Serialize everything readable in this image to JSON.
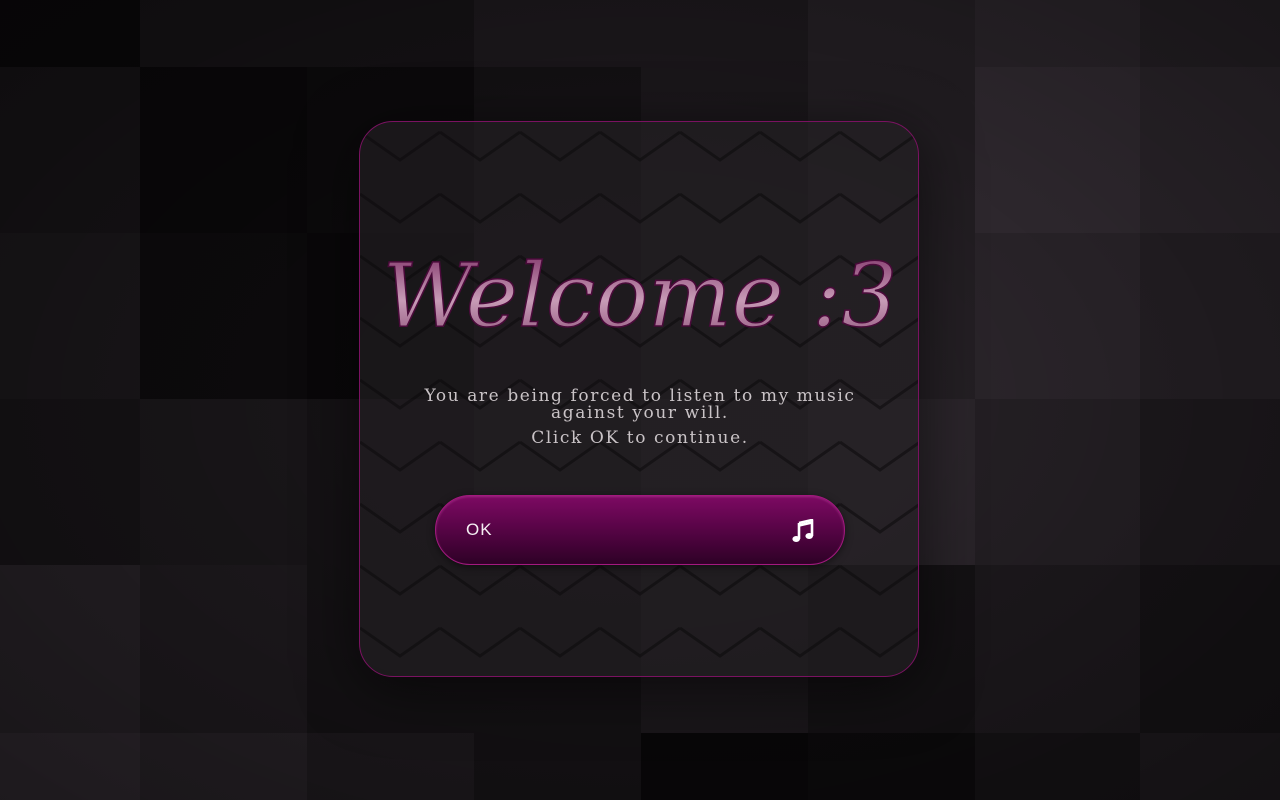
{
  "dialog": {
    "title": "Welcome :3",
    "message_line1": "You are being forced to listen to my music",
    "message_line2": "against your will.",
    "message_line3": "Click OK to continue.",
    "ok_label": "OK",
    "ok_icon": "music-note-icon"
  },
  "colors": {
    "accent": "#7a1261",
    "button_top": "#7d0a63",
    "button_bottom": "#2e0126",
    "text": "#c9c3c6",
    "title_fill": "#b0869f"
  },
  "background_palette": [
    "#0d0b0d",
    "#161316",
    "#1e1a1e",
    "#262126",
    "#2d272d",
    "#342d34",
    "#0a080a",
    "#1a171a"
  ]
}
